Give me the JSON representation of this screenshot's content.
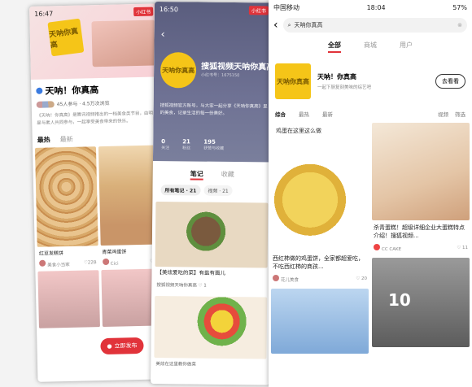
{
  "phone1": {
    "time": "16:47",
    "badge": "小红书",
    "logo_text": "天呐你真高",
    "title": "天呐！你真高",
    "meta": "45人参与 · 4.5万次浏览",
    "desc": "《天呐！你真高》是腾讯视频推出的一档美食类节目，由明星与素人共同参与，一起享受美食带来的快乐。",
    "tabs": [
      "最热",
      "最新"
    ],
    "cards": [
      {
        "title": "红豆发糕饼",
        "author": "美食小当家",
        "likes": "22B"
      },
      {
        "title": "青菜鸡蛋饼",
        "author": "Cici",
        "likes": "18"
      }
    ],
    "publish_label": "立即发布"
  },
  "phone2": {
    "time": "16:50",
    "badge": "小红书",
    "logo_text": "天呐你真高",
    "title": "搜狐视频天呐你真高",
    "subtitle": "小红书号：1675150",
    "desc": "搜狐视频官方账号，与大家一起分享《天呐你真高》里的美食，记录生活的每一份美好。",
    "stats": [
      {
        "value": "0",
        "label": "关注"
      },
      {
        "value": "21",
        "label": "粉丝"
      },
      {
        "value": "195",
        "label": "获赞与收藏"
      }
    ],
    "tabs": [
      "笔记",
      "收藏"
    ],
    "chips": [
      "所有笔记 · 21",
      "视频 · 21"
    ],
    "card_caption": "【美炫爱吃的菜】有盐有面儿",
    "card_author": "搜狐视频天呐你真高",
    "card_likes": "1",
    "bottom_caption": "美炫在这里教你做菜"
  },
  "phone3": {
    "carrier": "中国移动",
    "time": "18:04",
    "battery": "57%",
    "search_text": "天呐你真高",
    "categories": [
      "全部",
      "商城",
      "用户"
    ],
    "topic_title": "天呐！你真高",
    "topic_sub": "一起下厨复刻美味的综艺吧",
    "topic_btn": "去看看",
    "filters": [
      "综合",
      "最热",
      "最新"
    ],
    "filter_right": [
      "视频",
      "筛选"
    ],
    "overlay_text": "鸡蛋在这里这么做",
    "cards": [
      {
        "title": "西红柿做的鸡蛋饼，全家都超爱吃，不吃西红柿的商孩...",
        "author": "花儿美食",
        "likes": "20"
      },
      {
        "title": "杀青蛋糕！超级详细企业大蛋糕特点介绍！搜狐视频...",
        "author": "CC CAKE",
        "likes": "11"
      }
    ],
    "watch_text": "10"
  }
}
